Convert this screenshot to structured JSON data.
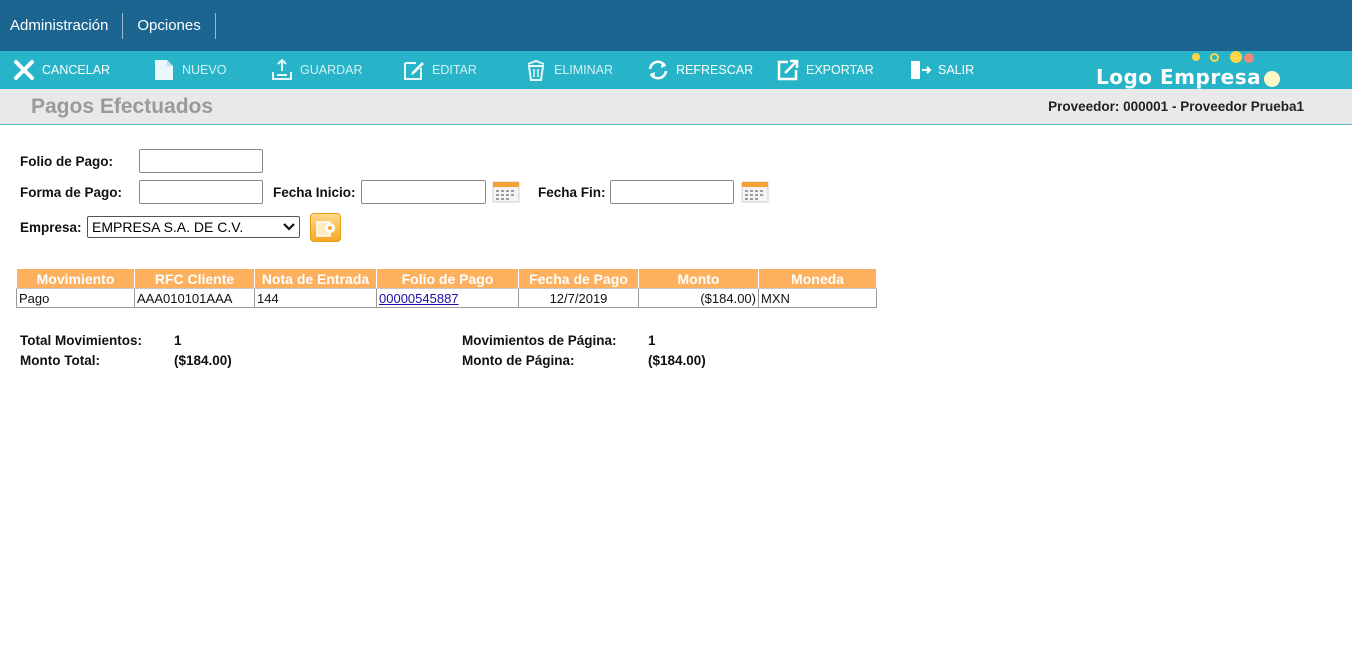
{
  "menu": {
    "items": [
      "Administración",
      "Opciones"
    ]
  },
  "toolbar": {
    "cancel": "CANCELAR",
    "new": "NUEVO",
    "save": "GUARDAR",
    "edit": "EDITAR",
    "delete": "ELIMINAR",
    "refresh": "REFRESCAR",
    "export": "EXPORTAR",
    "exit": "SALIR"
  },
  "logo": {
    "text": "Logo Empresa"
  },
  "header": {
    "title": "Pagos Efectuados",
    "provider": "Proveedor: 000001 - Proveedor Prueba1"
  },
  "form": {
    "folio_label": "Folio de Pago:",
    "folio_value": "",
    "forma_label": "Forma de Pago:",
    "forma_value": "",
    "fecha_inicio_label": "Fecha Inicio:",
    "fecha_inicio_value": "",
    "fecha_fin_label": "Fecha Fin:",
    "fecha_fin_value": "",
    "empresa_label": "Empresa:",
    "empresa_selected": "EMPRESA S.A. DE C.V."
  },
  "table": {
    "headers": [
      "Movimiento",
      "RFC Cliente",
      "Nota de Entrada",
      "Folio de Pago",
      "Fecha de Pago",
      "Monto",
      "Moneda"
    ],
    "rows": [
      [
        "Pago",
        "AAA010101AAA",
        "144",
        "00000545887",
        "12/7/2019",
        "($184.00)",
        "MXN"
      ]
    ]
  },
  "summary": {
    "total_mov_label": "Total Movimientos:",
    "total_mov_value": "1",
    "monto_total_label": "Monto Total:",
    "monto_total_value": "($184.00)",
    "mov_pagina_label": "Movimientos de Página:",
    "mov_pagina_value": "1",
    "monto_pagina_label": "Monto de Página:",
    "monto_pagina_value": "($184.00)"
  },
  "colors": {
    "menubar": "#1c6590",
    "toolbar": "#28b4c8",
    "table_header": "#fdb15f",
    "title_text": "#9a9a9a"
  }
}
